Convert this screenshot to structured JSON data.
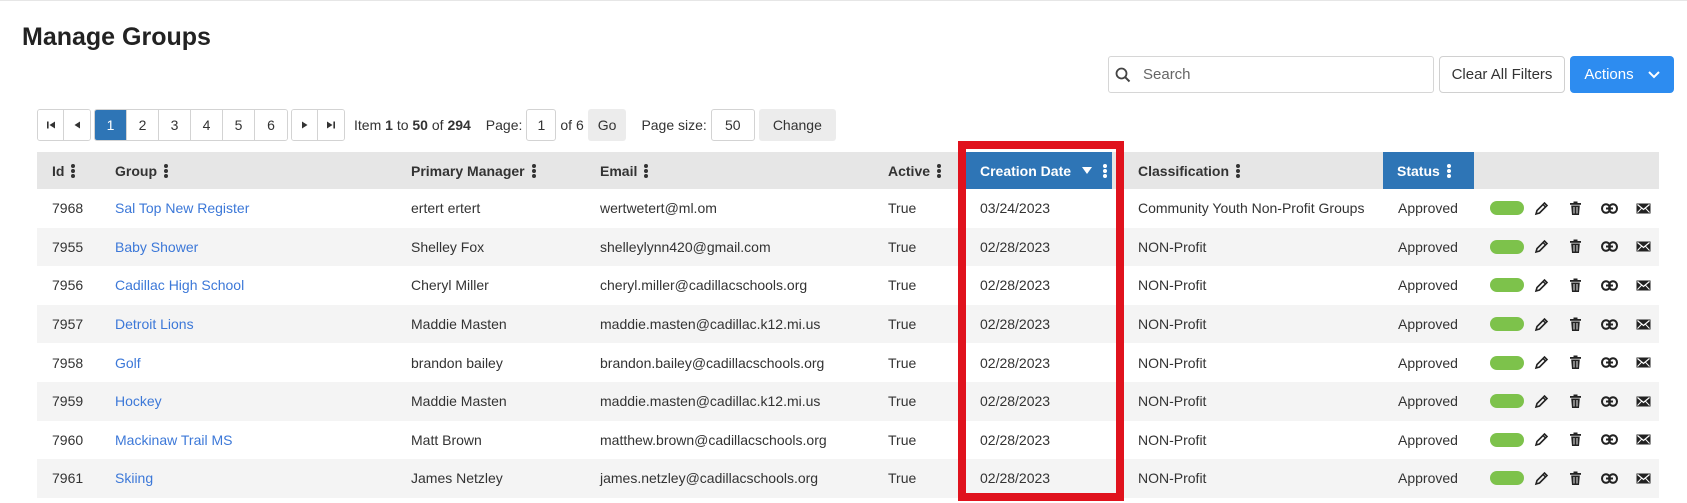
{
  "page": {
    "title": "Manage Groups"
  },
  "toolbar": {
    "search_placeholder": "Search",
    "search_value": "",
    "clear_label": "Clear All Filters",
    "actions_label": "Actions"
  },
  "pager": {
    "pages": [
      "1",
      "2",
      "3",
      "4",
      "5",
      "6"
    ],
    "current_page": "1",
    "item_prefix": "Item",
    "item_start": "1",
    "item_to": "to",
    "item_end": "50",
    "item_of": "of",
    "item_total": "294",
    "page_label": "Page:",
    "page_value": "1",
    "page_of": "of 6",
    "go_label": "Go",
    "size_label": "Page size:",
    "size_value": "50",
    "change_label": "Change"
  },
  "table": {
    "columns": {
      "id": "Id",
      "group": "Group",
      "manager": "Primary Manager",
      "email": "Email",
      "active": "Active",
      "created": "Creation Date",
      "classification": "Classification",
      "status": "Status"
    },
    "rows": [
      {
        "id": "7968",
        "group": "Sal Top New Register",
        "manager": "ertert ertert",
        "email": "wertwetert@ml.om",
        "active": "True",
        "created": "03/24/2023",
        "classification": "Community Youth Non-Profit Groups",
        "status": "Approved"
      },
      {
        "id": "7955",
        "group": "Baby Shower",
        "manager": "Shelley Fox",
        "email": "shelleylynn420@gmail.com",
        "active": "True",
        "created": "02/28/2023",
        "classification": "NON-Profit",
        "status": "Approved"
      },
      {
        "id": "7956",
        "group": "Cadillac High School",
        "manager": "Cheryl Miller",
        "email": "cheryl.miller@cadillacschools.org",
        "active": "True",
        "created": "02/28/2023",
        "classification": "NON-Profit",
        "status": "Approved"
      },
      {
        "id": "7957",
        "group": "Detroit Lions",
        "manager": "Maddie Masten",
        "email": "maddie.masten@cadillac.k12.mi.us",
        "active": "True",
        "created": "02/28/2023",
        "classification": "NON-Profit",
        "status": "Approved"
      },
      {
        "id": "7958",
        "group": "Golf",
        "manager": "brandon bailey",
        "email": "brandon.bailey@cadillacschools.org",
        "active": "True",
        "created": "02/28/2023",
        "classification": "NON-Profit",
        "status": "Approved"
      },
      {
        "id": "7959",
        "group": "Hockey",
        "manager": "Maddie Masten",
        "email": "maddie.masten@cadillac.k12.mi.us",
        "active": "True",
        "created": "02/28/2023",
        "classification": "NON-Profit",
        "status": "Approved"
      },
      {
        "id": "7960",
        "group": "Mackinaw Trail MS",
        "manager": "Matt Brown",
        "email": "matthew.brown@cadillacschools.org",
        "active": "True",
        "created": "02/28/2023",
        "classification": "NON-Profit",
        "status": "Approved"
      },
      {
        "id": "7961",
        "group": "Skiing",
        "manager": "James Netzley",
        "email": "james.netzley@cadillacschools.org",
        "active": "True",
        "created": "02/28/2023",
        "classification": "NON-Profit",
        "status": "Approved"
      }
    ]
  },
  "colors": {
    "accent": "#2e75b6",
    "primary_button": "#2d8cf0",
    "link": "#3c78d8",
    "status_active": "#7dc24b",
    "highlight": "#e0121d"
  },
  "icons": {
    "row_actions": [
      "status-dot",
      "pencil-icon",
      "trash-icon",
      "link-icon",
      "envelope-icon"
    ]
  }
}
